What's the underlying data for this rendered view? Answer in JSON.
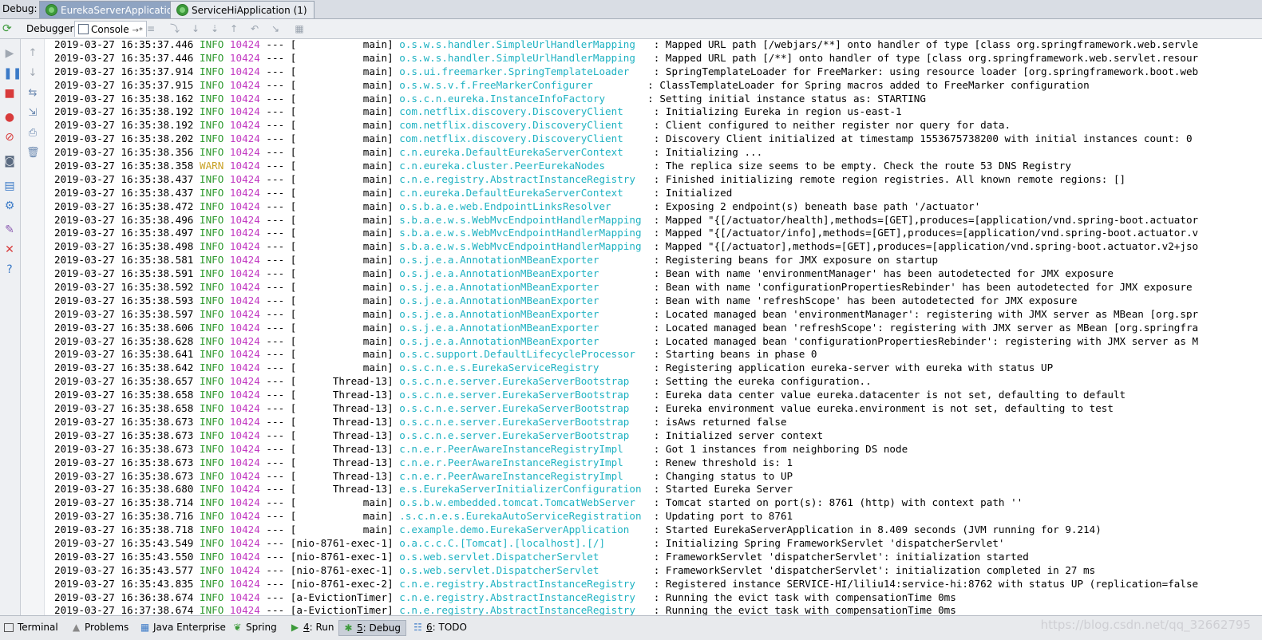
{
  "topbar": {
    "debug_label": "Debug:",
    "tabs": [
      {
        "label": "EurekaServerApplication",
        "active": true
      },
      {
        "label": "ServiceHiApplication (1)",
        "active": false
      }
    ]
  },
  "toolbar2": {
    "debugger_label": "Debugger",
    "console_label": "Console",
    "console_suffix": "→*"
  },
  "colors": {
    "info": "#2f9a2f",
    "warn": "#c9a227",
    "pid": "#c239c2",
    "logger": "#1fb2c2"
  },
  "log_lines": [
    {
      "ts": "2019-03-27 16:35:37.446",
      "level": "INFO",
      "pid": "10424",
      "thread": "           main]",
      "logger": "o.s.w.s.handler.SimpleUrlHandlerMapping  ",
      "msg": ": Mapped URL path [/webjars/**] onto handler of type [class org.springframework.web.servle"
    },
    {
      "ts": "2019-03-27 16:35:37.446",
      "level": "INFO",
      "pid": "10424",
      "thread": "           main]",
      "logger": "o.s.w.s.handler.SimpleUrlHandlerMapping  ",
      "msg": ": Mapped URL path [/**] onto handler of type [class org.springframework.web.servlet.resour"
    },
    {
      "ts": "2019-03-27 16:35:37.914",
      "level": "INFO",
      "pid": "10424",
      "thread": "           main]",
      "logger": "o.s.ui.freemarker.SpringTemplateLoader   ",
      "msg": ": SpringTemplateLoader for FreeMarker: using resource loader [org.springframework.boot.web"
    },
    {
      "ts": "2019-03-27 16:35:37.915",
      "level": "INFO",
      "pid": "10424",
      "thread": "           main]",
      "logger": "o.s.w.s.v.f.FreeMarkerConfigurer        ",
      "msg": ": ClassTemplateLoader for Spring macros added to FreeMarker configuration"
    },
    {
      "ts": "2019-03-27 16:35:38.162",
      "level": "INFO",
      "pid": "10424",
      "thread": "           main]",
      "logger": "o.s.c.n.eureka.InstanceInfoFactory      ",
      "msg": ": Setting initial instance status as: STARTING"
    },
    {
      "ts": "2019-03-27 16:35:38.192",
      "level": "INFO",
      "pid": "10424",
      "thread": "           main]",
      "logger": "com.netflix.discovery.DiscoveryClient    ",
      "msg": ": Initializing Eureka in region us-east-1"
    },
    {
      "ts": "2019-03-27 16:35:38.192",
      "level": "INFO",
      "pid": "10424",
      "thread": "           main]",
      "logger": "com.netflix.discovery.DiscoveryClient    ",
      "msg": ": Client configured to neither register nor query for data."
    },
    {
      "ts": "2019-03-27 16:35:38.202",
      "level": "INFO",
      "pid": "10424",
      "thread": "           main]",
      "logger": "com.netflix.discovery.DiscoveryClient    ",
      "msg": ": Discovery Client initialized at timestamp 1553675738200 with initial instances count: 0"
    },
    {
      "ts": "2019-03-27 16:35:38.356",
      "level": "INFO",
      "pid": "10424",
      "thread": "           main]",
      "logger": "c.n.eureka.DefaultEurekaServerContext    ",
      "msg": ": Initializing ..."
    },
    {
      "ts": "2019-03-27 16:35:38.358",
      "level": "WARN",
      "pid": "10424",
      "thread": "           main]",
      "logger": "c.n.eureka.cluster.PeerEurekaNodes       ",
      "msg": ": The replica size seems to be empty. Check the route 53 DNS Registry"
    },
    {
      "ts": "2019-03-27 16:35:38.437",
      "level": "INFO",
      "pid": "10424",
      "thread": "           main]",
      "logger": "c.n.e.registry.AbstractInstanceRegistry  ",
      "msg": ": Finished initializing remote region registries. All known remote regions: []"
    },
    {
      "ts": "2019-03-27 16:35:38.437",
      "level": "INFO",
      "pid": "10424",
      "thread": "           main]",
      "logger": "c.n.eureka.DefaultEurekaServerContext    ",
      "msg": ": Initialized"
    },
    {
      "ts": "2019-03-27 16:35:38.472",
      "level": "INFO",
      "pid": "10424",
      "thread": "           main]",
      "logger": "o.s.b.a.e.web.EndpointLinksResolver      ",
      "msg": ": Exposing 2 endpoint(s) beneath base path '/actuator'"
    },
    {
      "ts": "2019-03-27 16:35:38.496",
      "level": "INFO",
      "pid": "10424",
      "thread": "           main]",
      "logger": "s.b.a.e.w.s.WebMvcEndpointHandlerMapping ",
      "msg": ": Mapped \"{[/actuator/health],methods=[GET],produces=[application/vnd.spring-boot.actuator"
    },
    {
      "ts": "2019-03-27 16:35:38.497",
      "level": "INFO",
      "pid": "10424",
      "thread": "           main]",
      "logger": "s.b.a.e.w.s.WebMvcEndpointHandlerMapping ",
      "msg": ": Mapped \"{[/actuator/info],methods=[GET],produces=[application/vnd.spring-boot.actuator.v"
    },
    {
      "ts": "2019-03-27 16:35:38.498",
      "level": "INFO",
      "pid": "10424",
      "thread": "           main]",
      "logger": "s.b.a.e.w.s.WebMvcEndpointHandlerMapping ",
      "msg": ": Mapped \"{[/actuator],methods=[GET],produces=[application/vnd.spring-boot.actuator.v2+jso"
    },
    {
      "ts": "2019-03-27 16:35:38.581",
      "level": "INFO",
      "pid": "10424",
      "thread": "           main]",
      "logger": "o.s.j.e.a.AnnotationMBeanExporter        ",
      "msg": ": Registering beans for JMX exposure on startup"
    },
    {
      "ts": "2019-03-27 16:35:38.591",
      "level": "INFO",
      "pid": "10424",
      "thread": "           main]",
      "logger": "o.s.j.e.a.AnnotationMBeanExporter        ",
      "msg": ": Bean with name 'environmentManager' has been autodetected for JMX exposure"
    },
    {
      "ts": "2019-03-27 16:35:38.592",
      "level": "INFO",
      "pid": "10424",
      "thread": "           main]",
      "logger": "o.s.j.e.a.AnnotationMBeanExporter        ",
      "msg": ": Bean with name 'configurationPropertiesRebinder' has been autodetected for JMX exposure"
    },
    {
      "ts": "2019-03-27 16:35:38.593",
      "level": "INFO",
      "pid": "10424",
      "thread": "           main]",
      "logger": "o.s.j.e.a.AnnotationMBeanExporter        ",
      "msg": ": Bean with name 'refreshScope' has been autodetected for JMX exposure"
    },
    {
      "ts": "2019-03-27 16:35:38.597",
      "level": "INFO",
      "pid": "10424",
      "thread": "           main]",
      "logger": "o.s.j.e.a.AnnotationMBeanExporter        ",
      "msg": ": Located managed bean 'environmentManager': registering with JMX server as MBean [org.spr"
    },
    {
      "ts": "2019-03-27 16:35:38.606",
      "level": "INFO",
      "pid": "10424",
      "thread": "           main]",
      "logger": "o.s.j.e.a.AnnotationMBeanExporter        ",
      "msg": ": Located managed bean 'refreshScope': registering with JMX server as MBean [org.springfra"
    },
    {
      "ts": "2019-03-27 16:35:38.628",
      "level": "INFO",
      "pid": "10424",
      "thread": "           main]",
      "logger": "o.s.j.e.a.AnnotationMBeanExporter        ",
      "msg": ": Located managed bean 'configurationPropertiesRebinder': registering with JMX server as M"
    },
    {
      "ts": "2019-03-27 16:35:38.641",
      "level": "INFO",
      "pid": "10424",
      "thread": "           main]",
      "logger": "o.s.c.support.DefaultLifecycleProcessor  ",
      "msg": ": Starting beans in phase 0"
    },
    {
      "ts": "2019-03-27 16:35:38.642",
      "level": "INFO",
      "pid": "10424",
      "thread": "           main]",
      "logger": "o.s.c.n.e.s.EurekaServiceRegistry        ",
      "msg": ": Registering application eureka-server with eureka with status UP"
    },
    {
      "ts": "2019-03-27 16:35:38.657",
      "level": "INFO",
      "pid": "10424",
      "thread": "      Thread-13]",
      "logger": "o.s.c.n.e.server.EurekaServerBootstrap   ",
      "msg": ": Setting the eureka configuration.."
    },
    {
      "ts": "2019-03-27 16:35:38.658",
      "level": "INFO",
      "pid": "10424",
      "thread": "      Thread-13]",
      "logger": "o.s.c.n.e.server.EurekaServerBootstrap   ",
      "msg": ": Eureka data center value eureka.datacenter is not set, defaulting to default"
    },
    {
      "ts": "2019-03-27 16:35:38.658",
      "level": "INFO",
      "pid": "10424",
      "thread": "      Thread-13]",
      "logger": "o.s.c.n.e.server.EurekaServerBootstrap   ",
      "msg": ": Eureka environment value eureka.environment is not set, defaulting to test"
    },
    {
      "ts": "2019-03-27 16:35:38.673",
      "level": "INFO",
      "pid": "10424",
      "thread": "      Thread-13]",
      "logger": "o.s.c.n.e.server.EurekaServerBootstrap   ",
      "msg": ": isAws returned false"
    },
    {
      "ts": "2019-03-27 16:35:38.673",
      "level": "INFO",
      "pid": "10424",
      "thread": "      Thread-13]",
      "logger": "o.s.c.n.e.server.EurekaServerBootstrap   ",
      "msg": ": Initialized server context"
    },
    {
      "ts": "2019-03-27 16:35:38.673",
      "level": "INFO",
      "pid": "10424",
      "thread": "      Thread-13]",
      "logger": "c.n.e.r.PeerAwareInstanceRegistryImpl    ",
      "msg": ": Got 1 instances from neighboring DS node"
    },
    {
      "ts": "2019-03-27 16:35:38.673",
      "level": "INFO",
      "pid": "10424",
      "thread": "      Thread-13]",
      "logger": "c.n.e.r.PeerAwareInstanceRegistryImpl    ",
      "msg": ": Renew threshold is: 1"
    },
    {
      "ts": "2019-03-27 16:35:38.673",
      "level": "INFO",
      "pid": "10424",
      "thread": "      Thread-13]",
      "logger": "c.n.e.r.PeerAwareInstanceRegistryImpl    ",
      "msg": ": Changing status to UP"
    },
    {
      "ts": "2019-03-27 16:35:38.680",
      "level": "INFO",
      "pid": "10424",
      "thread": "      Thread-13]",
      "logger": "e.s.EurekaServerInitializerConfiguration ",
      "msg": ": Started Eureka Server"
    },
    {
      "ts": "2019-03-27 16:35:38.714",
      "level": "INFO",
      "pid": "10424",
      "thread": "           main]",
      "logger": "o.s.b.w.embedded.tomcat.TomcatWebServer  ",
      "msg": ": Tomcat started on port(s): 8761 (http) with context path ''"
    },
    {
      "ts": "2019-03-27 16:35:38.716",
      "level": "INFO",
      "pid": "10424",
      "thread": "           main]",
      "logger": ".s.c.n.e.s.EurekaAutoServiceRegistration ",
      "msg": ": Updating port to 8761"
    },
    {
      "ts": "2019-03-27 16:35:38.718",
      "level": "INFO",
      "pid": "10424",
      "thread": "           main]",
      "logger": "c.example.demo.EurekaServerApplication   ",
      "msg": ": Started EurekaServerApplication in 8.409 seconds (JVM running for 9.214)"
    },
    {
      "ts": "2019-03-27 16:35:43.549",
      "level": "INFO",
      "pid": "10424",
      "thread": "nio-8761-exec-1]",
      "logger": "o.a.c.c.C.[Tomcat].[localhost].[/]       ",
      "msg": ": Initializing Spring FrameworkServlet 'dispatcherServlet'"
    },
    {
      "ts": "2019-03-27 16:35:43.550",
      "level": "INFO",
      "pid": "10424",
      "thread": "nio-8761-exec-1]",
      "logger": "o.s.web.servlet.DispatcherServlet        ",
      "msg": ": FrameworkServlet 'dispatcherServlet': initialization started"
    },
    {
      "ts": "2019-03-27 16:35:43.577",
      "level": "INFO",
      "pid": "10424",
      "thread": "nio-8761-exec-1]",
      "logger": "o.s.web.servlet.DispatcherServlet        ",
      "msg": ": FrameworkServlet 'dispatcherServlet': initialization completed in 27 ms"
    },
    {
      "ts": "2019-03-27 16:35:43.835",
      "level": "INFO",
      "pid": "10424",
      "thread": "nio-8761-exec-2]",
      "logger": "c.n.e.registry.AbstractInstanceRegistry  ",
      "msg": ": Registered instance SERVICE-HI/liliu14:service-hi:8762 with status UP (replication=false"
    },
    {
      "ts": "2019-03-27 16:36:38.674",
      "level": "INFO",
      "pid": "10424",
      "thread": "a-EvictionTimer]",
      "logger": "c.n.e.registry.AbstractInstanceRegistry  ",
      "msg": ": Running the evict task with compensationTime 0ms"
    },
    {
      "ts": "2019-03-27 16:37:38.674",
      "level": "INFO",
      "pid": "10424",
      "thread": "a-EvictionTimer]",
      "logger": "c.n.e.registry.AbstractInstanceRegistry  ",
      "msg": ": Running the evict task with compensationTime 0ms"
    }
  ],
  "bottombar": {
    "tabs": [
      {
        "key": "",
        "label": "Terminal",
        "icon": "terminal-icon"
      },
      {
        "key": "",
        "label": "Problems",
        "icon": "warning-icon"
      },
      {
        "key": "",
        "label": "Java Enterprise",
        "icon": "java-enterprise-icon"
      },
      {
        "key": "",
        "label": "Spring",
        "icon": "spring-leaf-icon"
      },
      {
        "key": "4",
        "label": ": Run",
        "icon": "run-icon"
      },
      {
        "key": "5",
        "label": ": Debug",
        "icon": "debug-icon"
      },
      {
        "key": "6",
        "label": ": TODO",
        "icon": "todo-icon"
      }
    ]
  },
  "watermark": "https://blog.csdn.net/qq_32662795"
}
